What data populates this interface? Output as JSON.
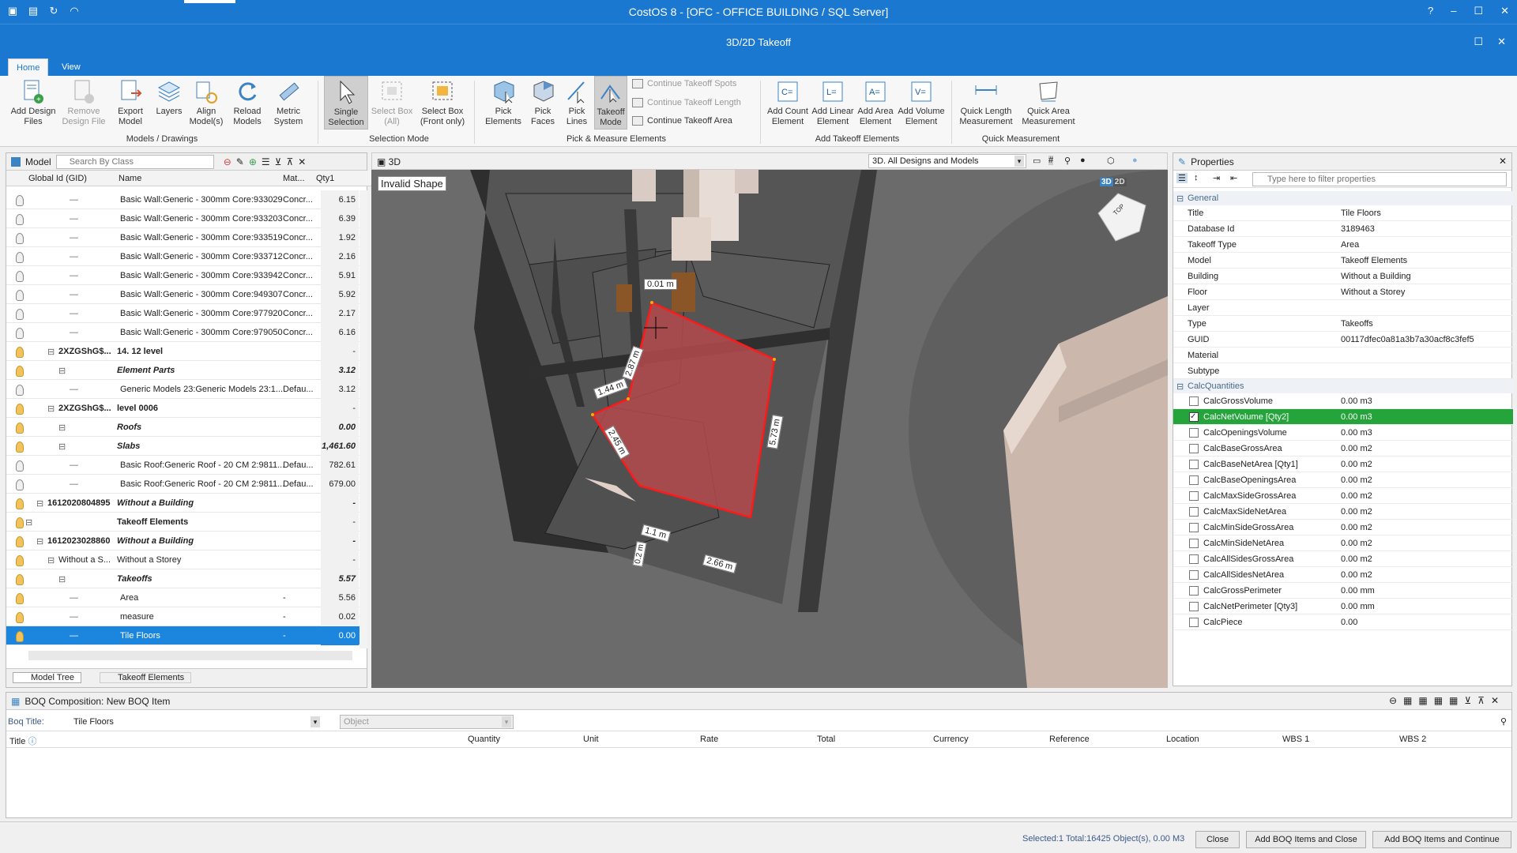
{
  "app": {
    "title": "CostOS 8 - [OFC - OFFICE BUILDING  / SQL Server]",
    "window_title": "3D/2D Takeoff"
  },
  "window_controls": {
    "help": "?",
    "minimize": "–",
    "maximize": "☐",
    "close": "✕"
  },
  "tabs": [
    {
      "label": "Home",
      "active": true
    },
    {
      "label": "View",
      "active": false
    }
  ],
  "ribbon": {
    "models_drawings": {
      "group_label": "Models / Drawings",
      "buttons": [
        {
          "label1": "Add Design",
          "label2": "Files",
          "icon": "add-design-files-icon",
          "enabled": true
        },
        {
          "label1": "Remove",
          "label2": "Design File",
          "icon": "remove-design-file-icon",
          "enabled": false
        },
        {
          "label1": "Export",
          "label2": "Model",
          "icon": "export-model-icon",
          "enabled": true
        },
        {
          "label1": "Layers",
          "label2": "",
          "icon": "layers-icon",
          "enabled": true
        },
        {
          "label1": "Align",
          "label2": "Model(s)",
          "icon": "align-models-icon",
          "enabled": true
        },
        {
          "label1": "Reload",
          "label2": "Models",
          "icon": "reload-models-icon",
          "enabled": true
        },
        {
          "label1": "Metric",
          "label2": "System",
          "icon": "metric-system-icon",
          "enabled": true
        }
      ]
    },
    "selection_mode": {
      "group_label": "Selection Mode",
      "buttons": [
        {
          "label1": "Single",
          "label2": "Selection",
          "enabled": true,
          "active": true
        },
        {
          "label1": "Select Box",
          "label2": "(All)",
          "enabled": false
        },
        {
          "label1": "Select Box",
          "label2": "(Front only)",
          "enabled": true
        }
      ]
    },
    "pick_measure": {
      "group_label": "Pick & Measure Elements",
      "buttons": [
        {
          "label1": "Pick",
          "label2": "Elements"
        },
        {
          "label1": "Pick",
          "label2": "Faces"
        },
        {
          "label1": "Pick",
          "label2": "Lines"
        },
        {
          "label1": "Takeoff",
          "label2": "Mode"
        }
      ],
      "small": [
        "Continue Takeoff Spots",
        "Continue Takeoff Length",
        "Continue Takeoff Area"
      ]
    },
    "add_takeoff": {
      "group_label": "Add Takeoff Elements",
      "buttons": [
        {
          "label1": "Add Count",
          "label2": "Element"
        },
        {
          "label1": "Add Linear",
          "label2": "Element"
        },
        {
          "label1": "Add Area",
          "label2": "Element"
        },
        {
          "label1": "Add Volume",
          "label2": "Element"
        }
      ]
    },
    "quick_measurement": {
      "group_label": "Quick Measurement",
      "buttons": [
        {
          "label1": "Quick Length",
          "label2": "Measurement"
        },
        {
          "label1": "Quick Area",
          "label2": "Measurement"
        }
      ]
    }
  },
  "model_panel": {
    "title": "Model",
    "search_placeholder": "Search By Class",
    "columns": {
      "gid": "Global Id (GID)",
      "name": "Name",
      "mat": "Mat...",
      "qty": "Qty1"
    },
    "rows": [
      {
        "gid": "",
        "name": "Basic Wall:Generic - 300mm  Core:933029",
        "mat": "Concr...",
        "qty": "6.15",
        "level": 4,
        "style": "",
        "bulb": false
      },
      {
        "gid": "",
        "name": "Basic Wall:Generic - 300mm  Core:933203",
        "mat": "Concr...",
        "qty": "6.39",
        "level": 4,
        "style": "",
        "bulb": false
      },
      {
        "gid": "",
        "name": "Basic Wall:Generic - 300mm  Core:933519",
        "mat": "Concr...",
        "qty": "1.92",
        "level": 4,
        "style": "",
        "bulb": false
      },
      {
        "gid": "",
        "name": "Basic Wall:Generic - 300mm  Core:933712",
        "mat": "Concr...",
        "qty": "2.16",
        "level": 4,
        "style": "",
        "bulb": false
      },
      {
        "gid": "",
        "name": "Basic Wall:Generic - 300mm  Core:933942",
        "mat": "Concr...",
        "qty": "5.91",
        "level": 4,
        "style": "",
        "bulb": false
      },
      {
        "gid": "",
        "name": "Basic Wall:Generic - 300mm  Core:949307",
        "mat": "Concr...",
        "qty": "5.92",
        "level": 4,
        "style": "",
        "bulb": false
      },
      {
        "gid": "",
        "name": "Basic Wall:Generic - 300mm  Core:977920",
        "mat": "Concr...",
        "qty": "2.17",
        "level": 4,
        "style": "",
        "bulb": false
      },
      {
        "gid": "",
        "name": "Basic Wall:Generic - 300mm  Core:979050",
        "mat": "Concr...",
        "qty": "6.16",
        "level": 4,
        "style": "",
        "bulb": false
      },
      {
        "gid": "2XZGShG$...",
        "name": "14. 12 level",
        "mat": "",
        "qty": "-",
        "level": 2,
        "style": "bold",
        "bulb": true
      },
      {
        "gid": "",
        "name": "Element Parts",
        "mat": "",
        "qty": "3.12",
        "level": 3,
        "style": "ital",
        "bulb": true
      },
      {
        "gid": "",
        "name": "Generic Models 23:Generic Models 23:1...",
        "mat": "Defau...",
        "qty": "3.12",
        "level": 4,
        "style": "",
        "bulb": false
      },
      {
        "gid": "2XZGShG$...",
        "name": "level 0006",
        "mat": "",
        "qty": "-",
        "level": 2,
        "style": "bold",
        "bulb": true
      },
      {
        "gid": "",
        "name": "Roofs",
        "mat": "",
        "qty": "0.00",
        "level": 3,
        "style": "ital",
        "bulb": true
      },
      {
        "gid": "",
        "name": "Slabs",
        "mat": "",
        "qty": "1,461.60",
        "level": 3,
        "style": "ital",
        "bulb": true
      },
      {
        "gid": "",
        "name": "Basic Roof:Generic Roof - 20 CM 2:9811...",
        "mat": "Defau...",
        "qty": "782.61",
        "level": 4,
        "style": "",
        "bulb": false
      },
      {
        "gid": "",
        "name": "Basic Roof:Generic Roof - 20 CM 2:9811...",
        "mat": "Defau...",
        "qty": "679.00",
        "level": 4,
        "style": "",
        "bulb": false
      },
      {
        "gid": "1612020804895",
        "name": "Without a Building",
        "mat": "",
        "qty": "-",
        "level": 1,
        "style": "ital",
        "bulb": true
      },
      {
        "gid": "",
        "name": "Takeoff Elements",
        "mat": "",
        "qty": "-",
        "level": 0,
        "style": "bold",
        "bulb": true
      },
      {
        "gid": "1612023028860",
        "name": "Without a Building",
        "mat": "",
        "qty": "-",
        "level": 1,
        "style": "ital",
        "bulb": true
      },
      {
        "gid": "Without a S...",
        "name": "Without a Storey",
        "mat": "",
        "qty": "-",
        "level": 2,
        "style": "",
        "bulb": true
      },
      {
        "gid": "",
        "name": "Takeoffs",
        "mat": "",
        "qty": "5.57",
        "level": 3,
        "style": "ital",
        "bulb": true
      },
      {
        "gid": "",
        "name": "Area",
        "mat": "-",
        "qty": "5.56",
        "level": 4,
        "style": "",
        "bulb": true
      },
      {
        "gid": "",
        "name": "measure",
        "mat": "-",
        "qty": "0.02",
        "level": 4,
        "style": "",
        "bulb": true
      },
      {
        "gid": "",
        "name": "Tile Floors",
        "mat": "-",
        "qty": "0.00",
        "level": 4,
        "style": "sel",
        "bulb": true
      }
    ],
    "bottom_tabs": [
      "Model Tree",
      "Takeoff Elements"
    ]
  },
  "view3d": {
    "tab_label": "3D",
    "invalid_label": "Invalid Shape",
    "designs_combo": "3D. All Designs and Models",
    "toggle_3d": "3D",
    "toggle_2d": "2D",
    "cube_label": "TOP",
    "measures": [
      "0.01 m",
      "2.87 m",
      "1.44 m",
      "2.45 m",
      "5.73 m",
      "1.1 m",
      "0.2 m",
      "2.66 m"
    ]
  },
  "properties": {
    "title": "Properties",
    "filter_placeholder": "Type here to filter properties",
    "general_label": "General",
    "general": [
      {
        "k": "Title",
        "v": "Tile Floors"
      },
      {
        "k": "Database Id",
        "v": "3189463"
      },
      {
        "k": "Takeoff Type",
        "v": "Area"
      },
      {
        "k": "Model",
        "v": "Takeoff Elements"
      },
      {
        "k": "Building",
        "v": "Without a Building"
      },
      {
        "k": "Floor",
        "v": "Without a Storey"
      },
      {
        "k": "Layer",
        "v": ""
      },
      {
        "k": "Type",
        "v": "Takeoffs"
      },
      {
        "k": "GUID",
        "v": "00117dfec0a81a3b7a30acf8c3fef5"
      },
      {
        "k": "Material",
        "v": ""
      },
      {
        "k": "Subtype",
        "v": ""
      }
    ],
    "calc_label": "CalcQuantities",
    "calc": [
      {
        "k": "CalcGrossVolume",
        "v": "0.00 m3",
        "checked": false,
        "hl": false
      },
      {
        "k": "CalcNetVolume [Qty2]",
        "v": "0.00 m3",
        "checked": true,
        "hl": true
      },
      {
        "k": "CalcOpeningsVolume",
        "v": "0.00 m3",
        "checked": false,
        "hl": false
      },
      {
        "k": "CalcBaseGrossArea",
        "v": "0.00 m2",
        "checked": false,
        "hl": false
      },
      {
        "k": "CalcBaseNetArea [Qty1]",
        "v": "0.00 m2",
        "checked": false,
        "hl": false
      },
      {
        "k": "CalcBaseOpeningsArea",
        "v": "0.00 m2",
        "checked": false,
        "hl": false
      },
      {
        "k": "CalcMaxSideGrossArea",
        "v": "0.00 m2",
        "checked": false,
        "hl": false
      },
      {
        "k": "CalcMaxSideNetArea",
        "v": "0.00 m2",
        "checked": false,
        "hl": false
      },
      {
        "k": "CalcMinSideGrossArea",
        "v": "0.00 m2",
        "checked": false,
        "hl": false
      },
      {
        "k": "CalcMinSideNetArea",
        "v": "0.00 m2",
        "checked": false,
        "hl": false
      },
      {
        "k": "CalcAllSidesGrossArea",
        "v": "0.00 m2",
        "checked": false,
        "hl": false
      },
      {
        "k": "CalcAllSidesNetArea",
        "v": "0.00 m2",
        "checked": false,
        "hl": false
      },
      {
        "k": "CalcGrossPerimeter",
        "v": "0.00 mm",
        "checked": false,
        "hl": false
      },
      {
        "k": "CalcNetPerimeter [Qty3]",
        "v": "0.00 mm",
        "checked": false,
        "hl": false
      },
      {
        "k": "CalcPiece",
        "v": "0.00",
        "checked": false,
        "hl": false
      }
    ]
  },
  "boq": {
    "title": "BOQ Composition: New BOQ Item",
    "boq_title_label": "Boq Title:",
    "boq_title_value": "Tile Floors",
    "object_placeholder": "Object",
    "columns": [
      "Title",
      "Quantity",
      "Unit",
      "Rate",
      "Total",
      "Currency",
      "Reference",
      "Location",
      "WBS 1",
      "WBS 2"
    ]
  },
  "status": {
    "text": "Selected:1 Total:16425  Object(s), 0.00 M3",
    "close": "Close",
    "add_close": "Add BOQ Items and Close",
    "add_continue": "Add BOQ Items and Continue"
  },
  "colors": {
    "accent": "#1b78d0",
    "selection": "#1c86de",
    "highlight": "#26a43c",
    "takeoff_area": "#b44a4e",
    "takeoff_edge": "#ff1a1a"
  }
}
